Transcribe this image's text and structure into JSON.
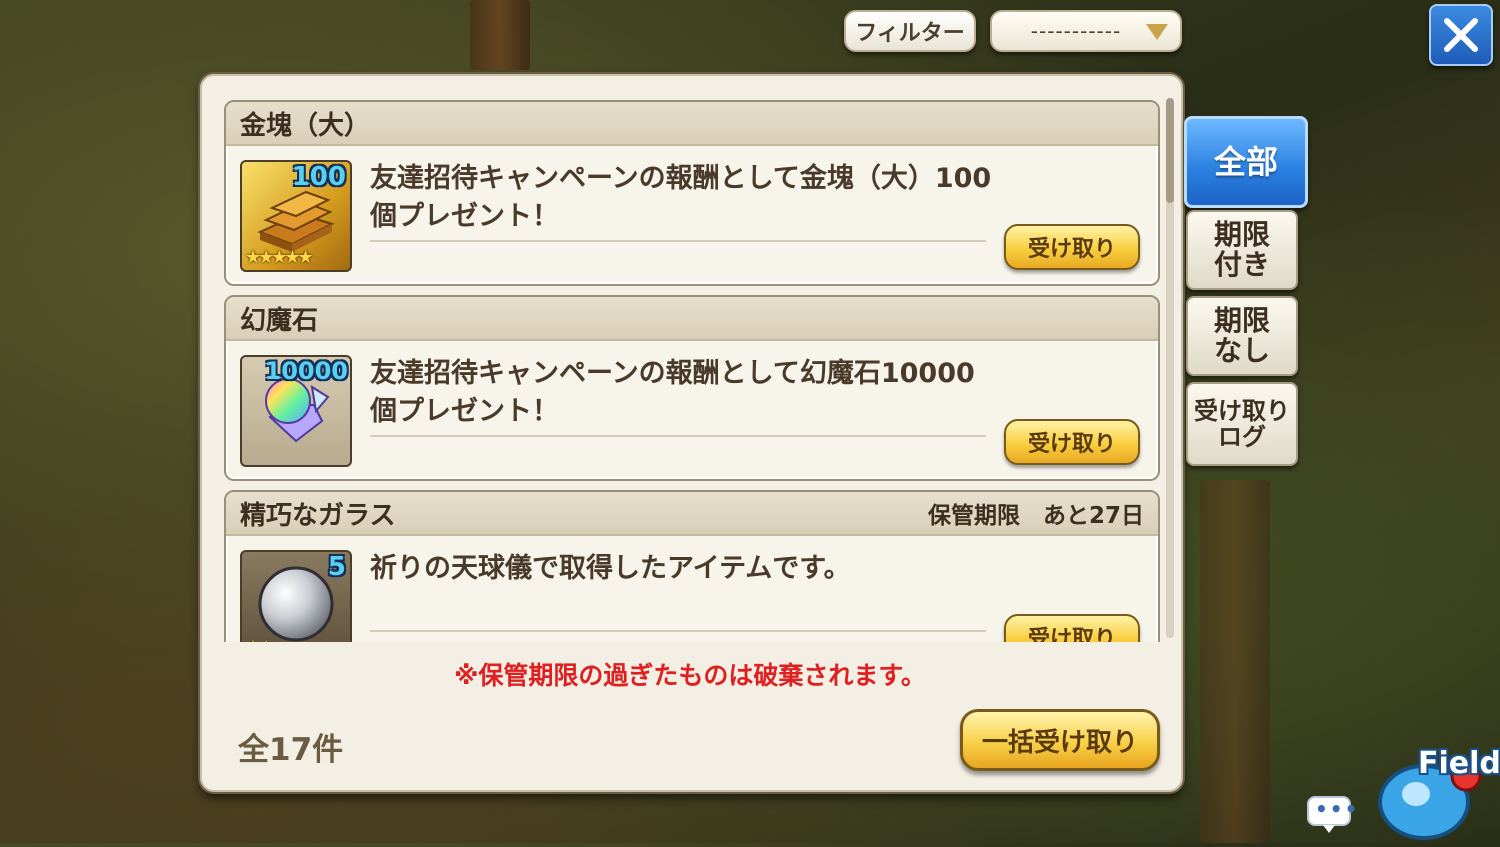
{
  "filter": {
    "button_label": "フィルター",
    "select_value": "-----------"
  },
  "panel": {
    "items": [
      {
        "name": "金塊（大）",
        "quantity": "100",
        "stars": "★★★★★",
        "description": "友達招待キャンペーンの報酬として金塊（大）100個プレゼント！",
        "receive_label": "受け取り",
        "icon": "gold-bars-icon"
      },
      {
        "name": "幻魔石",
        "quantity": "10000",
        "stars": "",
        "description": "友達招待キャンペーンの報酬として幻魔石10000個プレゼント！",
        "receive_label": "受け取り",
        "icon": "magicite-crystal-icon"
      },
      {
        "name": "精巧なガラス",
        "limit": "保管期限　あと27日",
        "quantity": "5",
        "stars": "★★",
        "description": "祈りの天球儀で取得したアイテムです。",
        "receive_label": "受け取り",
        "icon": "glass-orb-icon"
      }
    ],
    "notice": "※保管期限の過ぎたものは破棄されます。",
    "total": "全17件",
    "bulk_receive_label": "一括受け取り"
  },
  "tabs": [
    {
      "label": "全部",
      "active": true
    },
    {
      "label": "期限\n付き",
      "active": false
    },
    {
      "label": "期限\nなし",
      "active": false
    },
    {
      "label": "受け取り\nログ",
      "active": false
    }
  ],
  "hud": {
    "chat_dots": "•••",
    "field_label": "Field"
  },
  "colors": {
    "accent_blue": "#2a7fe0",
    "gold_button": "#f8cf3f",
    "notice_red": "#e02020"
  }
}
